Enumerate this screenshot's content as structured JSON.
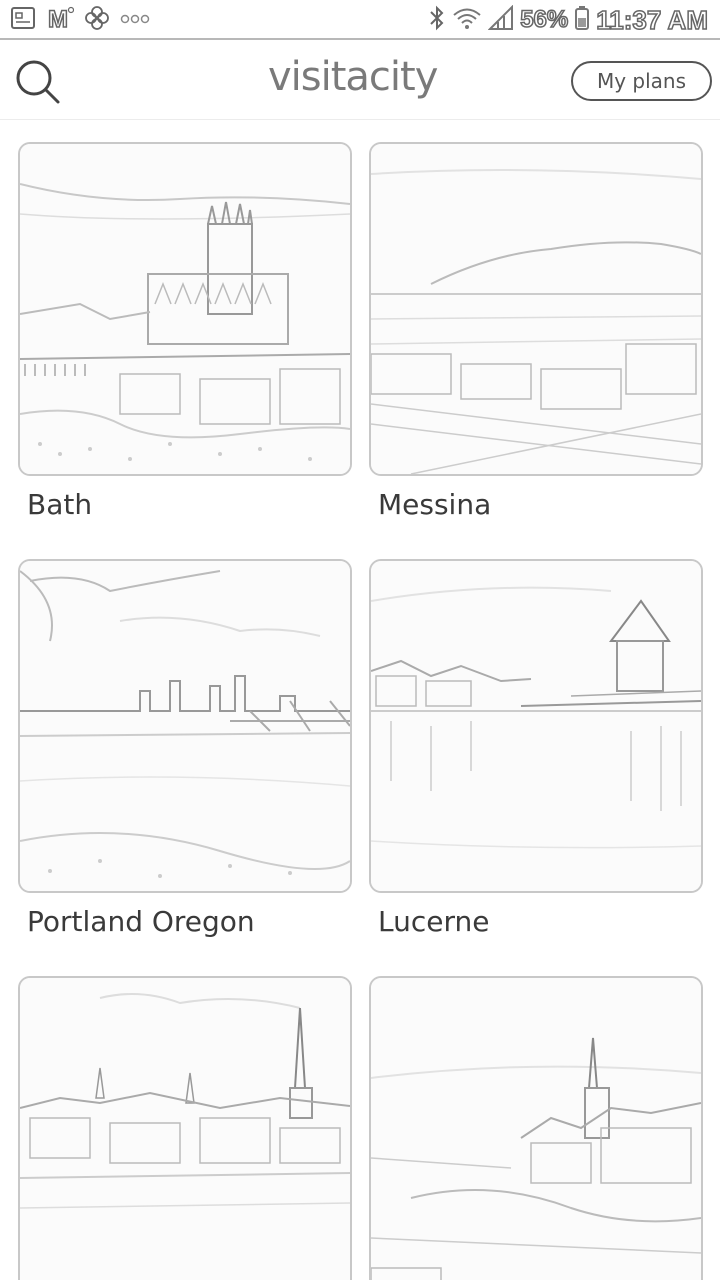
{
  "status_bar": {
    "battery_percent": "56%",
    "time": "11:37 AM",
    "left_icons": [
      "gallery-icon",
      "gmail-icon",
      "pinwheel-icon",
      "more-dots-icon"
    ],
    "right_icons": [
      "bluetooth-icon",
      "wifi-icon",
      "signal-icon",
      "battery-icon"
    ]
  },
  "header": {
    "logo": "visitacity",
    "my_plans_label": "My plans",
    "search_icon": "search-icon"
  },
  "cities": [
    {
      "name": "Bath"
    },
    {
      "name": "Messina"
    },
    {
      "name": "Portland Oregon"
    },
    {
      "name": "Lucerne"
    },
    {
      "name": "",
      "partially_visible": true
    },
    {
      "name": "",
      "partially_visible": true
    }
  ]
}
